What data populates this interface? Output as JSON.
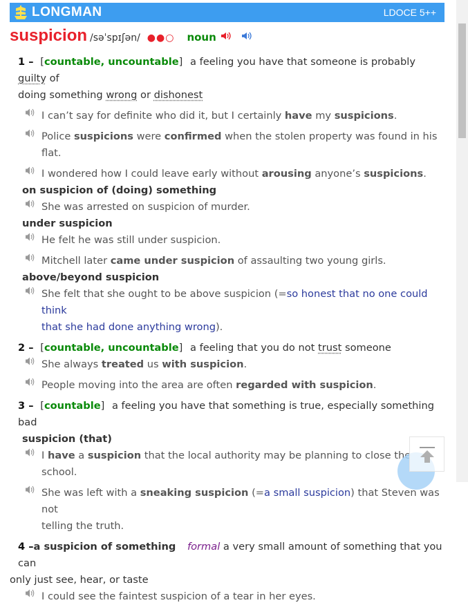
{
  "header": {
    "logo_text": "LONGMAN",
    "edition": "LDOCE 5++"
  },
  "entry": {
    "headword": "suspicion",
    "pronunciation": "/səˈspɪʃən/",
    "frequency": "●●○",
    "pos": "noun",
    "senses": [
      {
        "num": "1",
        "grammar": "countable, uncountable",
        "definition_a": "a feeling you have that someone is probably",
        "definition_guilty": "guilty",
        "definition_b": "of",
        "definition_c_pre": "doing something",
        "definition_wrong": "wrong",
        "definition_or": "or",
        "definition_dishonest": "dishonest",
        "examples": [
          {
            "a": "I can’t say for definite who did it, but I certainly ",
            "b1": "have",
            "c": " my ",
            "b2": "suspicions",
            "d": "."
          },
          {
            "a": "Police ",
            "b1": "suspicions",
            "c": " were ",
            "b2": "confirmed",
            "d": " when the stolen property was found in his flat."
          },
          {
            "a": "I wondered how I could leave early without ",
            "b1": "arousing",
            "c": " anyone’s ",
            "b2": "suspicions",
            "d": "."
          }
        ],
        "collocations": [
          {
            "phrase": "on suspicion of (doing) something",
            "examples": [
              {
                "text": "She was arrested on suspicion of murder."
              }
            ]
          },
          {
            "phrase": "under suspicion",
            "examples": [
              {
                "text": "He felt he was still under suspicion."
              },
              {
                "a": "Mitchell later ",
                "b": "came under suspicion",
                "c": " of assaulting two young girls."
              }
            ]
          },
          {
            "phrase": "above/beyond suspicion",
            "examples": [
              {
                "a": "She felt that she ought to be above suspicion (=",
                "gloss": "so honest that no one could think",
                "gloss2": "that she had done anything wrong",
                "c": ")."
              }
            ]
          }
        ]
      },
      {
        "num": "2",
        "grammar": "countable, uncountable",
        "definition_a": "a feeling that you do not",
        "definition_trust": "trust",
        "definition_b": "someone",
        "examples": [
          {
            "a": "She always ",
            "b1": "treated",
            "c": " us ",
            "b2": "with suspicion",
            "d": "."
          },
          {
            "a": "People moving into the area are often ",
            "b1": "regarded with suspicion",
            "c": ".",
            "b2": "",
            "d": ""
          }
        ]
      },
      {
        "num": "3",
        "grammar": "countable",
        "definition": "a feeling you have that something is true, especially something bad",
        "collocation": "suspicion (that)",
        "examples": [
          {
            "a": "I ",
            "b1": "have",
            "c": " a ",
            "b2": "suspicion",
            "d": " that the local authority may be planning to close the school."
          },
          {
            "a": "She was left with a ",
            "b1": "sneaking suspicion",
            "c": " (=",
            "gloss": "a small suspicion",
            "d": ") that Steven was not",
            "e": "telling the truth."
          }
        ]
      },
      {
        "num": "4",
        "phrase": "a suspicion of something",
        "register": "formal",
        "definition_a": "a very small amount of something that you can",
        "definition_b": "only just see, hear, or taste",
        "examples": [
          {
            "text": "I could see the faintest suspicion of a tear in her eyes."
          }
        ]
      }
    ]
  },
  "icons": {
    "speaker_uk": "speaker-red-icon",
    "speaker_us": "speaker-blue-icon",
    "example_audio": "speaker-gray-icon",
    "scroll_top": "arrow-up-icon"
  },
  "colors": {
    "header": "#3d9df0",
    "headword": "#e8212b",
    "pos": "#0a8a0a",
    "gloss": "#2b3a9c",
    "register": "#7a1e8c"
  }
}
